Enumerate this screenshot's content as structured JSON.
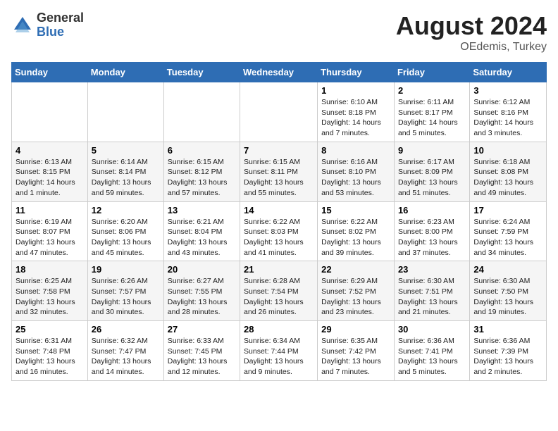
{
  "header": {
    "logo_general": "General",
    "logo_blue": "Blue",
    "title": "August 2024",
    "location": "OEdemis, Turkey"
  },
  "weekdays": [
    "Sunday",
    "Monday",
    "Tuesday",
    "Wednesday",
    "Thursday",
    "Friday",
    "Saturday"
  ],
  "weeks": [
    [
      {
        "day": "",
        "info": ""
      },
      {
        "day": "",
        "info": ""
      },
      {
        "day": "",
        "info": ""
      },
      {
        "day": "",
        "info": ""
      },
      {
        "day": "1",
        "info": "Sunrise: 6:10 AM\nSunset: 8:18 PM\nDaylight: 14 hours\nand 7 minutes."
      },
      {
        "day": "2",
        "info": "Sunrise: 6:11 AM\nSunset: 8:17 PM\nDaylight: 14 hours\nand 5 minutes."
      },
      {
        "day": "3",
        "info": "Sunrise: 6:12 AM\nSunset: 8:16 PM\nDaylight: 14 hours\nand 3 minutes."
      }
    ],
    [
      {
        "day": "4",
        "info": "Sunrise: 6:13 AM\nSunset: 8:15 PM\nDaylight: 14 hours\nand 1 minute."
      },
      {
        "day": "5",
        "info": "Sunrise: 6:14 AM\nSunset: 8:14 PM\nDaylight: 13 hours\nand 59 minutes."
      },
      {
        "day": "6",
        "info": "Sunrise: 6:15 AM\nSunset: 8:12 PM\nDaylight: 13 hours\nand 57 minutes."
      },
      {
        "day": "7",
        "info": "Sunrise: 6:15 AM\nSunset: 8:11 PM\nDaylight: 13 hours\nand 55 minutes."
      },
      {
        "day": "8",
        "info": "Sunrise: 6:16 AM\nSunset: 8:10 PM\nDaylight: 13 hours\nand 53 minutes."
      },
      {
        "day": "9",
        "info": "Sunrise: 6:17 AM\nSunset: 8:09 PM\nDaylight: 13 hours\nand 51 minutes."
      },
      {
        "day": "10",
        "info": "Sunrise: 6:18 AM\nSunset: 8:08 PM\nDaylight: 13 hours\nand 49 minutes."
      }
    ],
    [
      {
        "day": "11",
        "info": "Sunrise: 6:19 AM\nSunset: 8:07 PM\nDaylight: 13 hours\nand 47 minutes."
      },
      {
        "day": "12",
        "info": "Sunrise: 6:20 AM\nSunset: 8:06 PM\nDaylight: 13 hours\nand 45 minutes."
      },
      {
        "day": "13",
        "info": "Sunrise: 6:21 AM\nSunset: 8:04 PM\nDaylight: 13 hours\nand 43 minutes."
      },
      {
        "day": "14",
        "info": "Sunrise: 6:22 AM\nSunset: 8:03 PM\nDaylight: 13 hours\nand 41 minutes."
      },
      {
        "day": "15",
        "info": "Sunrise: 6:22 AM\nSunset: 8:02 PM\nDaylight: 13 hours\nand 39 minutes."
      },
      {
        "day": "16",
        "info": "Sunrise: 6:23 AM\nSunset: 8:00 PM\nDaylight: 13 hours\nand 37 minutes."
      },
      {
        "day": "17",
        "info": "Sunrise: 6:24 AM\nSunset: 7:59 PM\nDaylight: 13 hours\nand 34 minutes."
      }
    ],
    [
      {
        "day": "18",
        "info": "Sunrise: 6:25 AM\nSunset: 7:58 PM\nDaylight: 13 hours\nand 32 minutes."
      },
      {
        "day": "19",
        "info": "Sunrise: 6:26 AM\nSunset: 7:57 PM\nDaylight: 13 hours\nand 30 minutes."
      },
      {
        "day": "20",
        "info": "Sunrise: 6:27 AM\nSunset: 7:55 PM\nDaylight: 13 hours\nand 28 minutes."
      },
      {
        "day": "21",
        "info": "Sunrise: 6:28 AM\nSunset: 7:54 PM\nDaylight: 13 hours\nand 26 minutes."
      },
      {
        "day": "22",
        "info": "Sunrise: 6:29 AM\nSunset: 7:52 PM\nDaylight: 13 hours\nand 23 minutes."
      },
      {
        "day": "23",
        "info": "Sunrise: 6:30 AM\nSunset: 7:51 PM\nDaylight: 13 hours\nand 21 minutes."
      },
      {
        "day": "24",
        "info": "Sunrise: 6:30 AM\nSunset: 7:50 PM\nDaylight: 13 hours\nand 19 minutes."
      }
    ],
    [
      {
        "day": "25",
        "info": "Sunrise: 6:31 AM\nSunset: 7:48 PM\nDaylight: 13 hours\nand 16 minutes."
      },
      {
        "day": "26",
        "info": "Sunrise: 6:32 AM\nSunset: 7:47 PM\nDaylight: 13 hours\nand 14 minutes."
      },
      {
        "day": "27",
        "info": "Sunrise: 6:33 AM\nSunset: 7:45 PM\nDaylight: 13 hours\nand 12 minutes."
      },
      {
        "day": "28",
        "info": "Sunrise: 6:34 AM\nSunset: 7:44 PM\nDaylight: 13 hours\nand 9 minutes."
      },
      {
        "day": "29",
        "info": "Sunrise: 6:35 AM\nSunset: 7:42 PM\nDaylight: 13 hours\nand 7 minutes."
      },
      {
        "day": "30",
        "info": "Sunrise: 6:36 AM\nSunset: 7:41 PM\nDaylight: 13 hours\nand 5 minutes."
      },
      {
        "day": "31",
        "info": "Sunrise: 6:36 AM\nSunset: 7:39 PM\nDaylight: 13 hours\nand 2 minutes."
      }
    ]
  ]
}
